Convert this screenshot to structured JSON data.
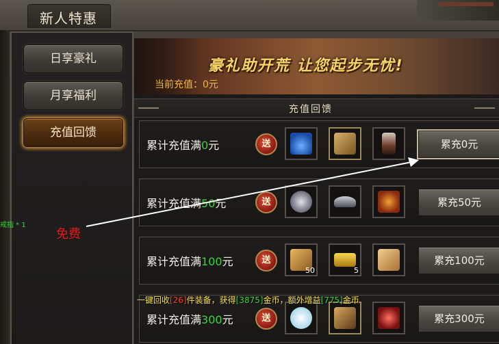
{
  "window": {
    "title": "新人特惠"
  },
  "sidebar": {
    "items": [
      {
        "label": "日享豪礼",
        "active": false
      },
      {
        "label": "月享福利",
        "active": false
      },
      {
        "label": "充值回馈",
        "active": true
      }
    ]
  },
  "banner": {
    "slogan": "豪礼助开荒 让您起步无忧!",
    "current_label": "当前充值：0元"
  },
  "section": {
    "title": "充值回馈"
  },
  "rows": [
    {
      "prefix": "累计充值满",
      "amount": "0",
      "suffix": "元",
      "badge": "送",
      "button": "累充0元",
      "items": [
        {
          "icon": "potion-icon",
          "color": "#2a6ad8",
          "count": ""
        },
        {
          "icon": "book-icon",
          "color": "#b58a3a",
          "count": ""
        },
        {
          "icon": "vase-icon",
          "color": "#8a5a4a",
          "count": ""
        }
      ]
    },
    {
      "prefix": "累计充值满",
      "amount": "50",
      "suffix": "元",
      "badge": "送",
      "button": "累充50元",
      "items": [
        {
          "icon": "pouch-icon",
          "color": "#9a9aa8",
          "count": ""
        },
        {
          "icon": "hat-icon",
          "color": "#8a9aa8",
          "count": ""
        },
        {
          "icon": "armor-icon",
          "color": "#c8781a",
          "count": ""
        }
      ]
    },
    {
      "prefix": "累计充值满",
      "amount": "100",
      "suffix": "元",
      "badge": "送",
      "button": "累充100元",
      "items": [
        {
          "icon": "scroll-icon",
          "color": "#c8933a",
          "count": "50"
        },
        {
          "icon": "gold-bar-icon",
          "color": "#e0b02a",
          "count": "5"
        },
        {
          "icon": "talisman-icon",
          "color": "#d8a84a",
          "count": ""
        }
      ]
    },
    {
      "prefix": "累计充值满",
      "amount": "300",
      "suffix": "元",
      "badge": "送",
      "button": "累充300元",
      "items": [
        {
          "icon": "crystal-icon",
          "color": "#c8e8f0",
          "count": ""
        },
        {
          "icon": "relic-icon",
          "color": "#a87a3a",
          "count": ""
        },
        {
          "icon": "emblem-icon",
          "color": "#c83a3a",
          "count": ""
        }
      ]
    }
  ],
  "annotation": {
    "free_text": "免费"
  },
  "side_text": {
    "ring": "戒指 * 1"
  },
  "recycle": {
    "part1": "一键回收",
    "count": "[26]",
    "part2": "件装备，获得",
    "gold": "[3875]",
    "part3": "金币，额外增益",
    "bonus": "[775]",
    "part4": "金币"
  }
}
